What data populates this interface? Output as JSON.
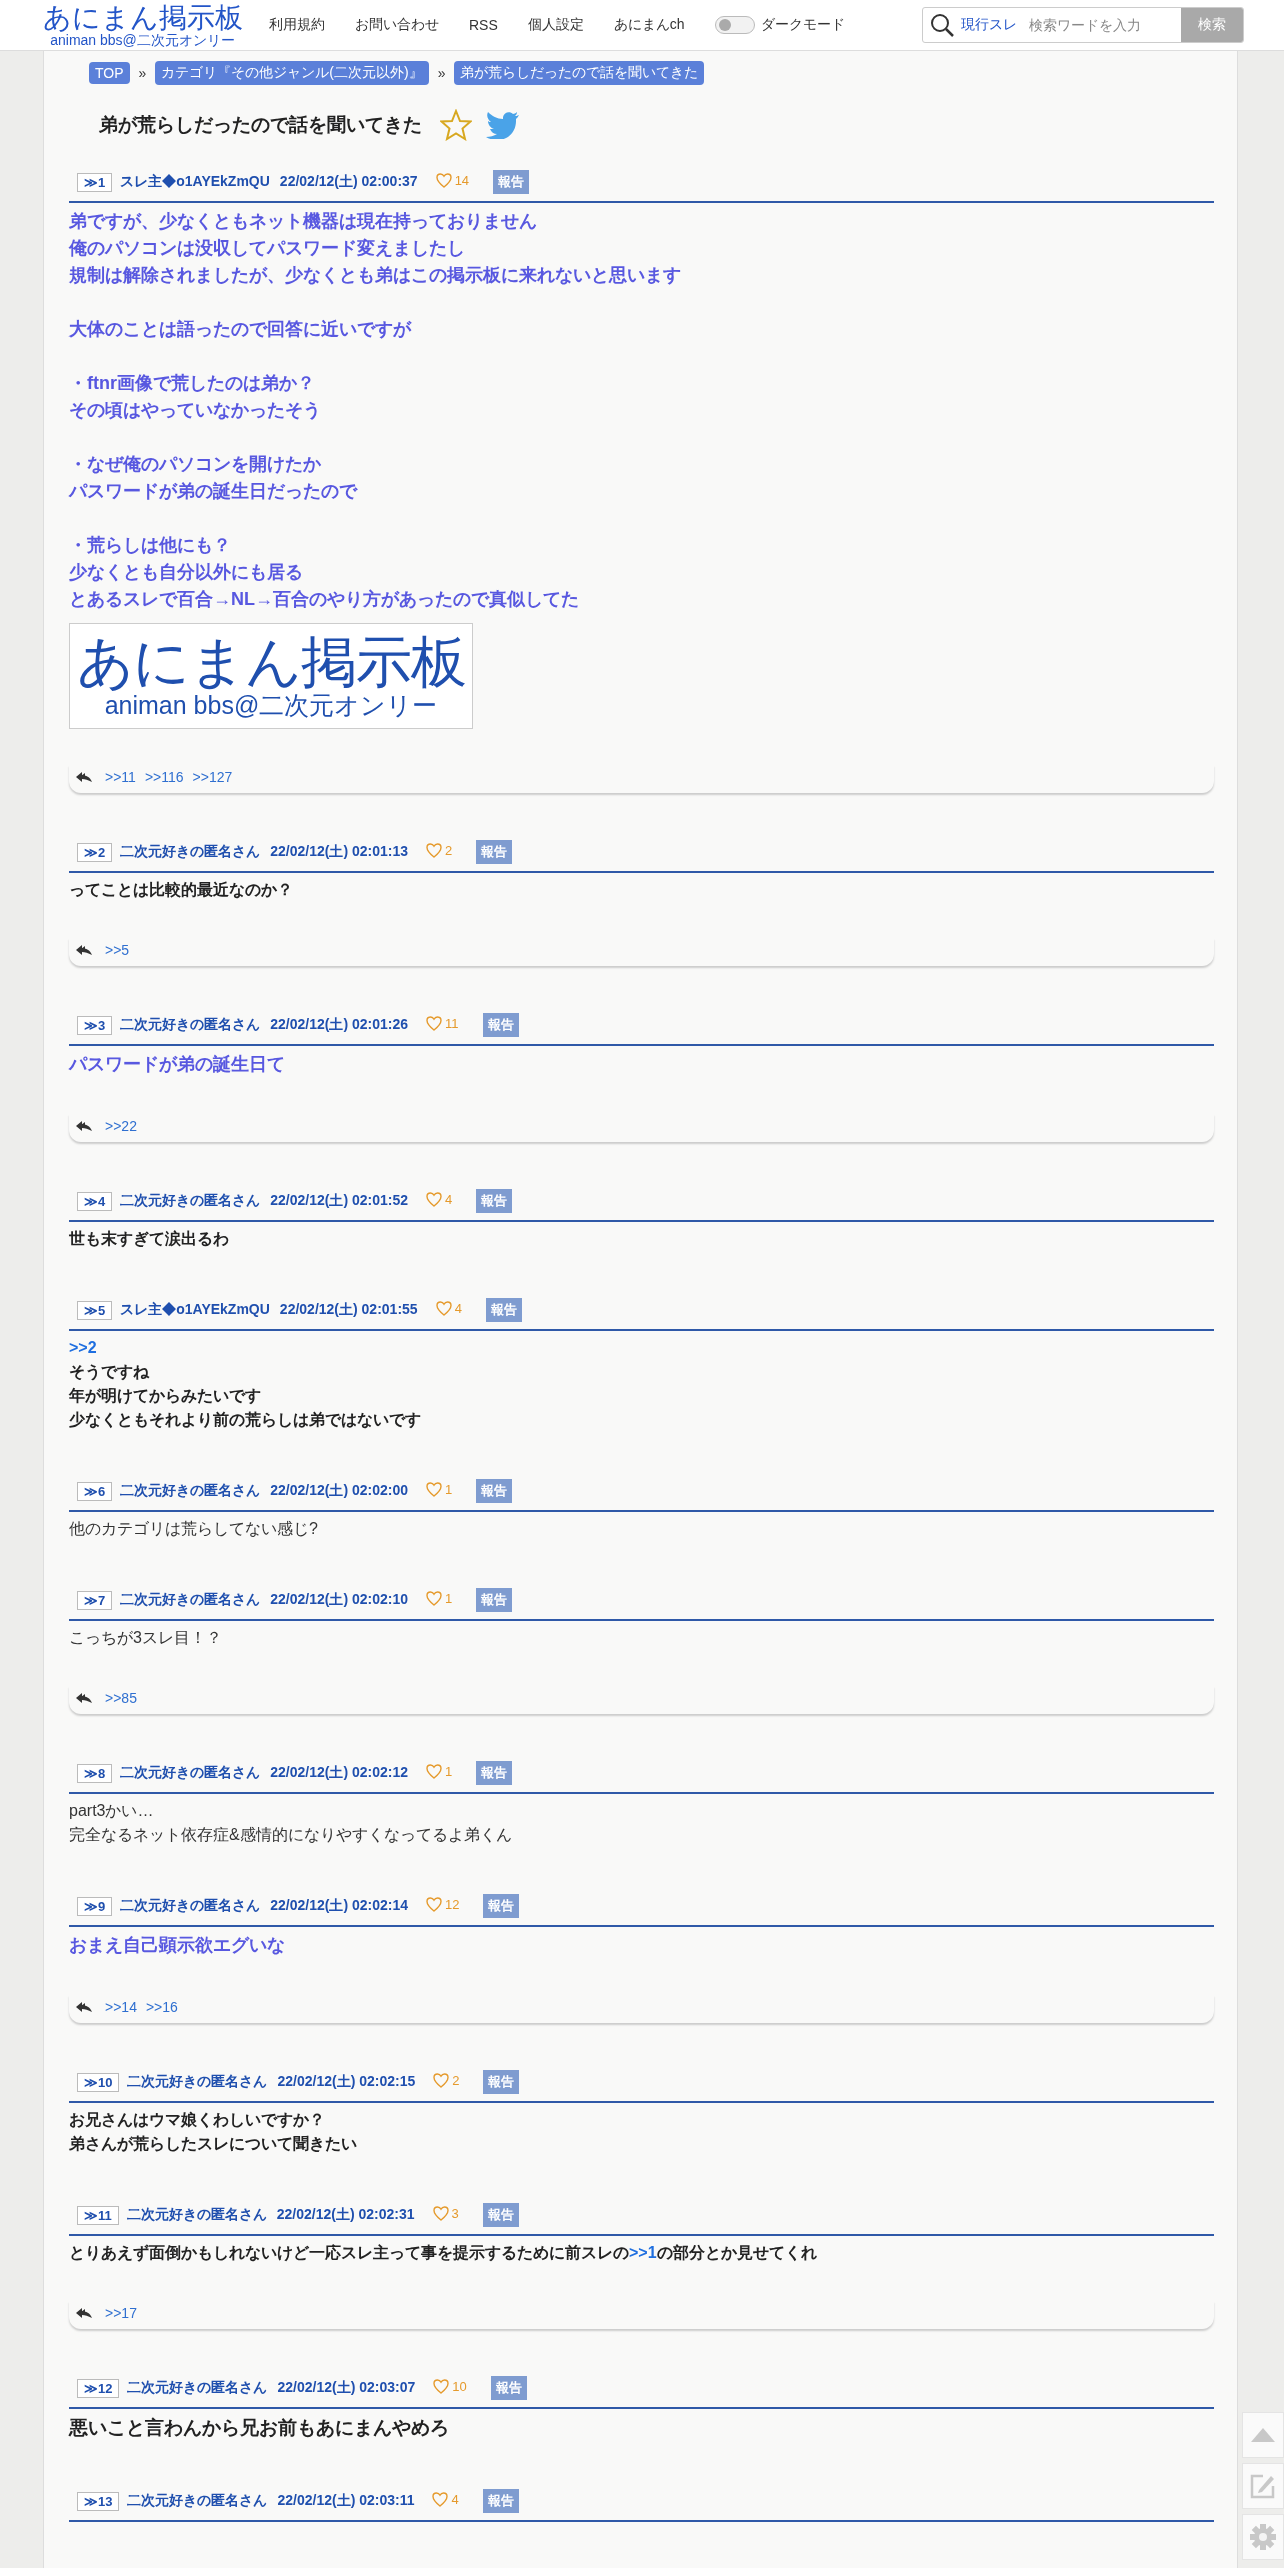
{
  "header": {
    "logo": {
      "title": "あにまん掲示板",
      "subtitle": "animan bbs@二次元オンリー"
    },
    "nav": [
      "利用規約",
      "お問い合わせ",
      "RSS",
      "個人設定",
      "あにまんch"
    ],
    "dark_mode": {
      "label": "ダークモード",
      "on": false
    },
    "search": {
      "scope": "現行スレ",
      "placeholder": "検索ワードを入力",
      "button": "検索"
    }
  },
  "breadcrumbs": {
    "separator": "»",
    "items": [
      "TOP",
      "カテゴリ『その他ジャンル(二次元以外)』",
      "弟が荒らしだったので話を聞いてきた"
    ]
  },
  "thread": {
    "title": "弟が荒らしだったので話を聞いてきた",
    "favorite": false
  },
  "posts": [
    {
      "number": "≫1",
      "name": "スレ主◆o1AYEkZmQU",
      "date": "22/02/12(土) 02:00:37",
      "likes": "14",
      "report": "報告",
      "kind": "highlight",
      "paragraphs": [
        [
          "弟ですが、少なくともネット機器は現在持っておりません",
          "俺のパソコンは没収してパスワード変えましたし",
          "規制は解除されましたが、少なくとも弟はこの掲示板に来れないと思います"
        ],
        [
          "大体のことは語ったので回答に近いですが"
        ],
        [
          "・ftnr画像で荒したのは弟か？",
          "その頃はやっていなかったそう"
        ],
        [
          "・なぜ俺のパソコンを開けたか",
          "パスワードが弟の誕生日だったので"
        ],
        [
          "・荒らしは他にも？",
          "少なくとも自分以外にも居る",
          "とあるスレで百合→NL→百合のやり方があったので真似してた"
        ]
      ],
      "attachment": {
        "title": "あにまん掲示板",
        "subtitle": "animan bbs@二次元オンリー"
      },
      "replies": [
        ">>11",
        ">>116",
        ">>127"
      ]
    },
    {
      "number": "≫2",
      "name": "二次元好きの匿名さん",
      "date": "22/02/12(土) 02:01:13",
      "likes": "2",
      "report": "報告",
      "kind": "bold",
      "paragraphs": [
        [
          "ってことは比較的最近なのか？"
        ]
      ],
      "replies": [
        ">>5"
      ]
    },
    {
      "number": "≫3",
      "name": "二次元好きの匿名さん",
      "date": "22/02/12(土) 02:01:26",
      "likes": "11",
      "report": "報告",
      "kind": "highlight",
      "paragraphs": [
        [
          "パスワードが弟の誕生日て"
        ]
      ],
      "replies": [
        ">>22"
      ]
    },
    {
      "number": "≫4",
      "name": "二次元好きの匿名さん",
      "date": "22/02/12(土) 02:01:52",
      "likes": "4",
      "report": "報告",
      "kind": "bold",
      "paragraphs": [
        [
          "世も末すぎて涙出るわ"
        ]
      ]
    },
    {
      "number": "≫5",
      "name": "スレ主◆o1AYEkZmQU",
      "date": "22/02/12(土) 02:01:55",
      "likes": "4",
      "report": "報告",
      "kind": "bold",
      "paragraphs": [
        [
          [
            {
              "text": ">>2",
              "kind": "anchor"
            }
          ],
          "そうですね",
          "年が明けてからみたいです",
          "少なくともそれより前の荒らしは弟ではないです"
        ]
      ]
    },
    {
      "number": "≫6",
      "name": "二次元好きの匿名さん",
      "date": "22/02/12(土) 02:02:00",
      "likes": "1",
      "report": "報告",
      "kind": "plain",
      "paragraphs": [
        [
          "他のカテゴリは荒らしてない感じ?"
        ]
      ]
    },
    {
      "number": "≫7",
      "name": "二次元好きの匿名さん",
      "date": "22/02/12(土) 02:02:10",
      "likes": "1",
      "report": "報告",
      "kind": "plain",
      "paragraphs": [
        [
          "こっちが3スレ目！？"
        ]
      ],
      "replies": [
        ">>85"
      ]
    },
    {
      "number": "≫8",
      "name": "二次元好きの匿名さん",
      "date": "22/02/12(土) 02:02:12",
      "likes": "1",
      "report": "報告",
      "kind": "plain",
      "paragraphs": [
        [
          "part3かい…",
          "完全なるネット依存症&感情的になりやすくなってるよ弟くん"
        ]
      ]
    },
    {
      "number": "≫9",
      "name": "二次元好きの匿名さん",
      "date": "22/02/12(土) 02:02:14",
      "likes": "12",
      "report": "報告",
      "kind": "highlight",
      "paragraphs": [
        [
          "おまえ自己顕示欲エグいな"
        ]
      ],
      "replies": [
        ">>14",
        ">>16"
      ]
    },
    {
      "number": "≫10",
      "name": "二次元好きの匿名さん",
      "date": "22/02/12(土) 02:02:15",
      "likes": "2",
      "report": "報告",
      "kind": "bold",
      "paragraphs": [
        [
          "お兄さんはウマ娘くわしいですか？",
          "弟さんが荒らしたスレについて聞きたい"
        ]
      ]
    },
    {
      "number": "≫11",
      "name": "二次元好きの匿名さん",
      "date": "22/02/12(土) 02:02:31",
      "likes": "3",
      "report": "報告",
      "kind": "bold",
      "paragraphs": [
        [
          [
            {
              "text": "とりあえず面倒かもしれないけど一応スレ主って事を提示するために前スレの",
              "kind": "text"
            },
            {
              "text": ">>1",
              "kind": "anchor"
            },
            {
              "text": "の部分とか見せてくれ",
              "kind": "text"
            }
          ]
        ]
      ],
      "replies": [
        ">>17"
      ]
    },
    {
      "number": "≫12",
      "name": "二次元好きの匿名さん",
      "date": "22/02/12(土) 02:03:07",
      "likes": "10",
      "report": "報告",
      "kind": "large",
      "paragraphs": [
        [
          "悪いこと言わんから兄お前もあにまんやめろ"
        ]
      ]
    },
    {
      "number": "≫13",
      "name": "二次元好きの匿名さん",
      "date": "22/02/12(土) 02:03:11",
      "likes": "4",
      "report": "報告"
    }
  ]
}
